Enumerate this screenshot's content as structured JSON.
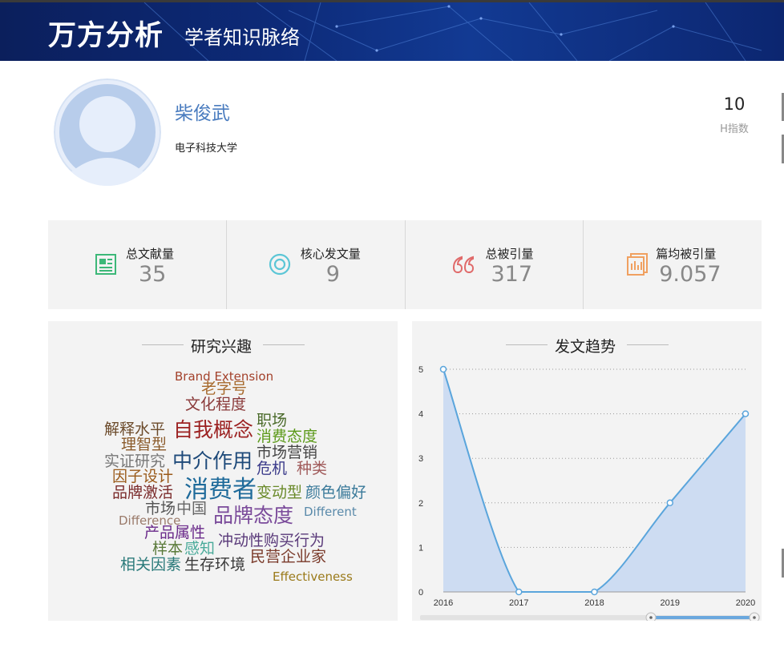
{
  "header": {
    "brand": "万方分析",
    "subtitle": "学者知识脉络"
  },
  "profile": {
    "name": "柴俊武",
    "affiliation": "电子科技大学",
    "h_index_value": "10",
    "h_index_label": "H指数"
  },
  "stats": [
    {
      "label": "总文献量",
      "value": "35",
      "icon": "document-icon",
      "color": "#3cb878"
    },
    {
      "label": "核心发文量",
      "value": "9",
      "icon": "target-icon",
      "color": "#5bc6d6"
    },
    {
      "label": "总被引量",
      "value": "317",
      "icon": "quote-icon",
      "color": "#e06a6a"
    },
    {
      "label": "篇均被引量",
      "value": "9.057",
      "icon": "bar-doc-icon",
      "color": "#f0a060"
    }
  ],
  "interests": {
    "title": "研究兴趣",
    "words": [
      {
        "text": "Brand Extension",
        "color": "#a3412b"
      },
      {
        "text": "老字号",
        "color": "#a86b2e"
      },
      {
        "text": "文化程度",
        "color": "#8a3a3a"
      },
      {
        "text": "解释水平",
        "color": "#6b4a2a"
      },
      {
        "text": "自我概念",
        "color": "#9c2222"
      },
      {
        "text": "职场",
        "color": "#4a6a2a"
      },
      {
        "text": "理智型",
        "color": "#8a5a2a"
      },
      {
        "text": "消费态度",
        "color": "#5c9a1a"
      },
      {
        "text": "实证研究",
        "color": "#777777"
      },
      {
        "text": "中介作用",
        "color": "#1e4a7a"
      },
      {
        "text": "市场营销",
        "color": "#444444"
      },
      {
        "text": "因子设计",
        "color": "#9a5a1a"
      },
      {
        "text": "危机",
        "color": "#3a3a8a"
      },
      {
        "text": "种类",
        "color": "#a05a5a"
      },
      {
        "text": "品牌激活",
        "color": "#7a2a2a"
      },
      {
        "text": "消费者",
        "color": "#1e6a9a"
      },
      {
        "text": "变动型",
        "color": "#6a8a2a"
      },
      {
        "text": "颜色偏好",
        "color": "#3a7a9a"
      },
      {
        "text": "市场",
        "color": "#555555"
      },
      {
        "text": "中国",
        "color": "#666666"
      },
      {
        "text": "品牌态度",
        "color": "#7a4a9a"
      },
      {
        "text": "Different",
        "color": "#5a8aaa"
      },
      {
        "text": "Difference",
        "color": "#9a7a6a"
      },
      {
        "text": "产品属性",
        "color": "#6a2a8a"
      },
      {
        "text": "冲动性购买行为",
        "color": "#5a3a7a"
      },
      {
        "text": "样本",
        "color": "#5a7a3a"
      },
      {
        "text": "感知",
        "color": "#4aaa9a"
      },
      {
        "text": "民营企业家",
        "color": "#7a3a2a"
      },
      {
        "text": "相关因素",
        "color": "#2a7a7a"
      },
      {
        "text": "生存环境",
        "color": "#3a3a3a"
      },
      {
        "text": "Effectiveness",
        "color": "#9a7a1a"
      }
    ]
  },
  "trend": {
    "title": "发文趋势"
  },
  "chart_data": {
    "type": "area",
    "title": "发文趋势",
    "x": [
      "2016",
      "2017",
      "2018",
      "2019",
      "2020"
    ],
    "series": [
      {
        "values": [
          5,
          0,
          0,
          2,
          4
        ]
      }
    ],
    "ylim": [
      0,
      5
    ],
    "yticks": [
      "0",
      "1",
      "2",
      "3",
      "4",
      "5"
    ],
    "grid": true,
    "line_color": "#5aa5dc",
    "fill_color": "#cddcf2"
  }
}
